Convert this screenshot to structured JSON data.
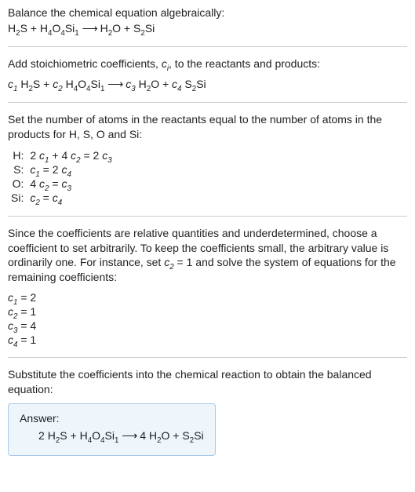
{
  "intro": {
    "line1": "Balance the chemical equation algebraically:",
    "reaction_plain": "H₂S + H₄O₄Si₁ ⟶ H₂O + S₂Si"
  },
  "step1": {
    "text_prefix": "Add stoichiometric coefficients, ",
    "ci": "cᵢ",
    "text_suffix": ", to the reactants and products:"
  },
  "step2": {
    "text": "Set the number of atoms in the reactants equal to the number of atoms in the products for H, S, O and Si:",
    "rows": [
      {
        "label": "H:",
        "eq_left": "2 c₁ + 4 c₂",
        "eq_right": "2 c₃"
      },
      {
        "label": "S:",
        "eq_left": "c₁",
        "eq_right": "2 c₄"
      },
      {
        "label": "O:",
        "eq_left": "4 c₂",
        "eq_right": "c₃"
      },
      {
        "label": "Si:",
        "eq_left": "c₂",
        "eq_right": "c₄"
      }
    ]
  },
  "step3": {
    "text": "Since the coefficients are relative quantities and underdetermined, choose a coefficient to set arbitrarily. To keep the coefficients small, the arbitrary value is ordinarily one. For instance, set c₂ = 1 and solve the system of equations for the remaining coefficients:",
    "coeffs": [
      {
        "name": "c₁",
        "val": "2"
      },
      {
        "name": "c₂",
        "val": "1"
      },
      {
        "name": "c₃",
        "val": "4"
      },
      {
        "name": "c₄",
        "val": "1"
      }
    ]
  },
  "step4": {
    "text": "Substitute the coefficients into the chemical reaction to obtain the balanced equation:"
  },
  "answer": {
    "label": "Answer:",
    "equation": "2 H₂S + H₄O₄Si₁ ⟶ 4 H₂O + S₂Si"
  },
  "chem": {
    "H2S": {
      "H": "H",
      "H2": "2",
      "S": "S"
    },
    "H4O4Si1": {
      "H": "H",
      "H4": "4",
      "O": "O",
      "O4": "4",
      "Si": "Si",
      "Si1": "1"
    },
    "H2O": {
      "H": "H",
      "H2": "2",
      "O": "O"
    },
    "S2Si": {
      "S": "S",
      "S2": "2",
      "Si": "Si"
    },
    "plus": " + ",
    "arrow": "⟶",
    "c": "c",
    "eq": " = ",
    "sp": " ",
    "two": "2 ",
    "four": "4 "
  },
  "ci_sub": "i"
}
